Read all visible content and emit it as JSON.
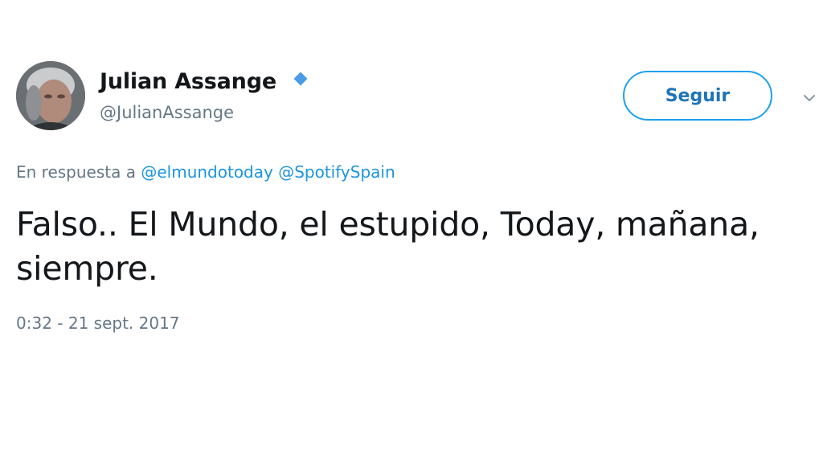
{
  "author": {
    "display_name": "Julian Assange",
    "handle": "@JulianAssange",
    "verified_icon": "verified-diamond-icon",
    "avatar_icon": "profile-photo"
  },
  "actions": {
    "follow_label": "Seguir",
    "menu_icon": "chevron-down-icon"
  },
  "reply_context": {
    "prefix": "En respuesta a",
    "mentions": [
      "@elmundotoday",
      "@SpotifySpain"
    ]
  },
  "tweet": {
    "text": "Falso.. El Mundo, el estupido, Today, mañana, siempre.",
    "timestamp": "0:32 - 21 sept. 2017"
  },
  "colors": {
    "accent": "#1da1f2",
    "mention": "#1b95e0",
    "secondary_text": "#657786",
    "primary_text": "#14171a"
  }
}
